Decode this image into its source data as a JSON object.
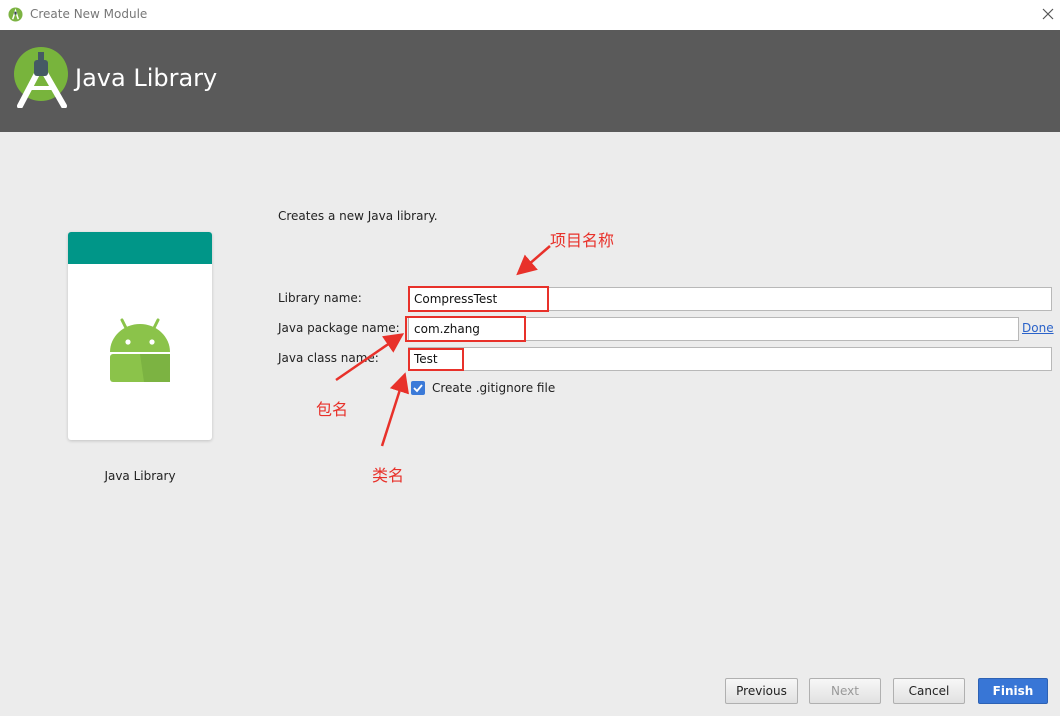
{
  "window": {
    "title": "Create New Module",
    "icon": "android-studio-icon",
    "close_icon": "close-icon"
  },
  "header": {
    "heading": "Java Library",
    "logo_icon": "android-studio-logo-icon"
  },
  "preview": {
    "label": "Java Library",
    "icon": "android-robot-icon",
    "accent_color": "#009688"
  },
  "form": {
    "description": "Creates a new Java library.",
    "library_name": {
      "label": "Library name:",
      "value": "CompressTest"
    },
    "package_name": {
      "label": "Java package name:",
      "value": "com.zhang",
      "done_link": "Done"
    },
    "class_name": {
      "label": "Java class name:",
      "value": "Test"
    },
    "gitignore": {
      "label": "Create .gitignore file",
      "checked": true
    }
  },
  "annotations": {
    "project_name": "项目名称",
    "package_name": "包名",
    "class_name": "类名",
    "color": "#e8312a"
  },
  "buttons": {
    "previous": "Previous",
    "next": "Next",
    "cancel": "Cancel",
    "finish": "Finish"
  }
}
